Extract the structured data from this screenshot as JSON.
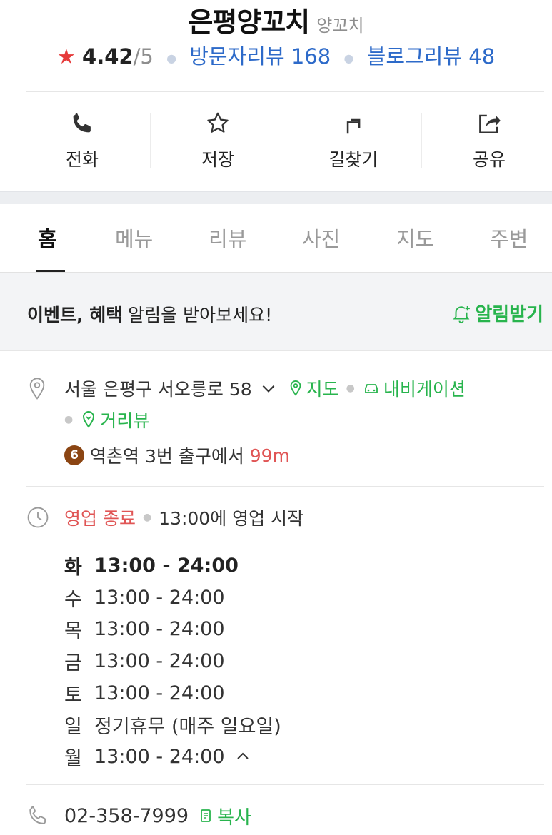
{
  "place": {
    "title": "은평양꼬치",
    "category": "양꼬치"
  },
  "rating": {
    "star": "★",
    "score": "4.42",
    "max": "/5",
    "visitor_reviews": "방문자리뷰 168",
    "blog_reviews": "블로그리뷰 48"
  },
  "actions": [
    {
      "label": "전화",
      "icon": "phone-icon"
    },
    {
      "label": "저장",
      "icon": "star-outline-icon"
    },
    {
      "label": "길찾기",
      "icon": "turn-right-arrow-icon"
    },
    {
      "label": "공유",
      "icon": "share-icon"
    }
  ],
  "tabs": [
    "홈",
    "메뉴",
    "리뷰",
    "사진",
    "지도",
    "주변"
  ],
  "notice": {
    "bold": "이벤트, 혜택",
    "rest": " 알림을 받아보세요!",
    "button": "알림받기"
  },
  "address": {
    "text": "서울 은평구 서오릉로 58",
    "map_link": "지도",
    "nav_link": "내비게이션",
    "street_view_link": "거리뷰",
    "subway_line": "6",
    "subway_line_color": "#8b4513",
    "station": "역촌역",
    "exit": " 3번 출구에서 ",
    "distance": "99m"
  },
  "hours": {
    "status": "영업 종료",
    "next": "13:00에 영업 시작",
    "rows": [
      {
        "day": "화",
        "time": "13:00 - 24:00"
      },
      {
        "day": "수",
        "time": "13:00 - 24:00"
      },
      {
        "day": "목",
        "time": "13:00 - 24:00"
      },
      {
        "day": "금",
        "time": "13:00 - 24:00"
      },
      {
        "day": "토",
        "time": "13:00 - 24:00"
      },
      {
        "day": "일",
        "time": "정기휴무 (매주 일요일)"
      },
      {
        "day": "월",
        "time": "13:00 - 24:00"
      }
    ]
  },
  "phone": {
    "number": "02-358-7999",
    "copy_label": "복사"
  },
  "colors": {
    "accent_green": "#28b44d",
    "link_blue": "#2d6ac9",
    "alert_red": "#e05555",
    "star_red": "#e63a3a"
  }
}
